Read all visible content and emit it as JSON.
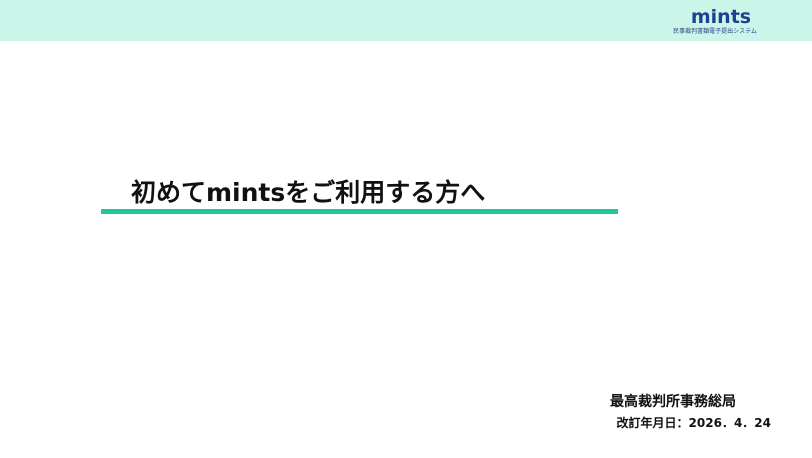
{
  "header": {
    "logo_text": "mints",
    "logo_subtitle": "民事裁判書類電子提出システム",
    "band_color": "#ccf5ea",
    "logo_color": "#1f3f8f"
  },
  "main": {
    "title": "初めてmintsをご利用する方へ",
    "rule_color": "#22c89b"
  },
  "footer": {
    "organization": "最高裁判所事務総局",
    "revision": "改訂年月日：2026．4．24"
  }
}
